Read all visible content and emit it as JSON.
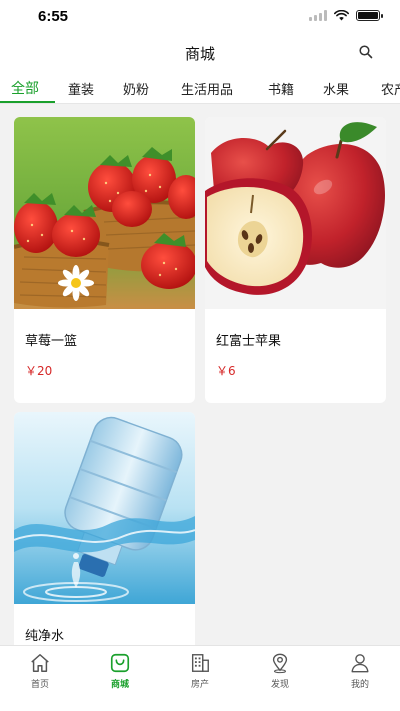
{
  "status": {
    "time": "6:55"
  },
  "header": {
    "title": "商城",
    "search_icon": "search-icon"
  },
  "tabs": [
    {
      "label": "全部",
      "active": true
    },
    {
      "label": "童装"
    },
    {
      "label": "奶粉"
    },
    {
      "label": "生活用品"
    },
    {
      "label": "书籍"
    },
    {
      "label": "水果"
    },
    {
      "label": "农产"
    }
  ],
  "products": [
    {
      "name": "草莓一篮",
      "price": "￥20",
      "image": "strawberries-image"
    },
    {
      "name": "红富士苹果",
      "price": "￥6",
      "image": "apples-image"
    },
    {
      "name": "纯净水",
      "price": "",
      "image": "water-bottle-image"
    }
  ],
  "tabbar": [
    {
      "label": "首页",
      "icon": "home-icon"
    },
    {
      "label": "商城",
      "icon": "shop-icon",
      "active": true
    },
    {
      "label": "房产",
      "icon": "building-icon"
    },
    {
      "label": "发现",
      "icon": "location-icon"
    },
    {
      "label": "我的",
      "icon": "person-icon"
    }
  ],
  "colors": {
    "accent": "#1aa02c",
    "price": "#d62828",
    "background": "#f2f2f2"
  }
}
